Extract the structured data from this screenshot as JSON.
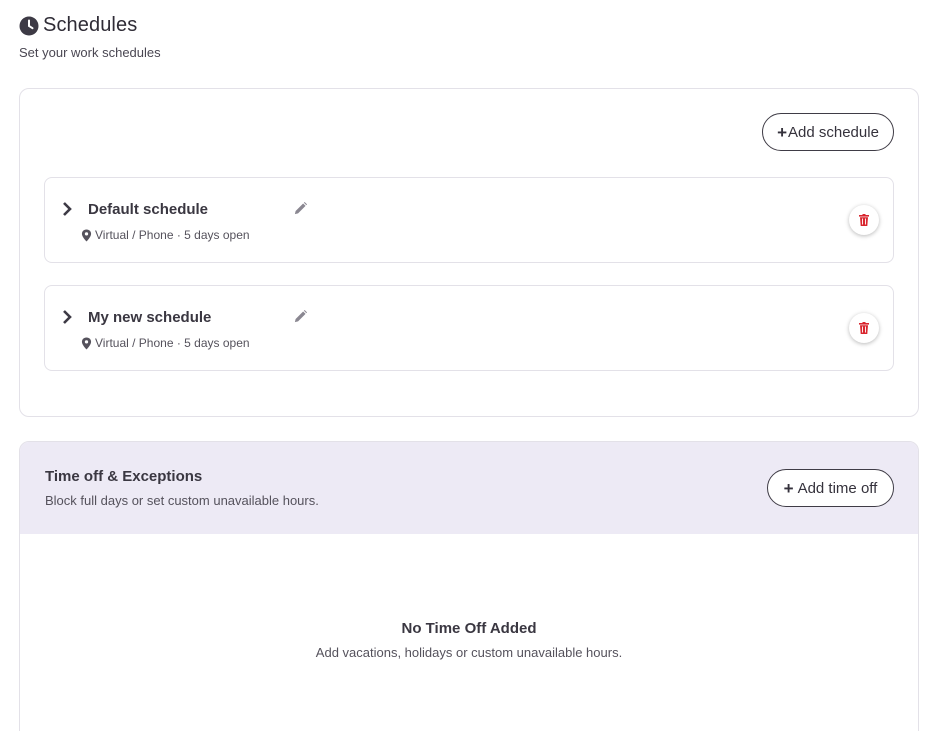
{
  "header": {
    "title": "Schedules",
    "subtitle": "Set your work schedules"
  },
  "schedules": {
    "add_button_label": "Add schedule",
    "items": [
      {
        "name": "Default schedule",
        "meta": "Virtual / Phone · 5 days open"
      },
      {
        "name": "My new schedule",
        "meta": "Virtual / Phone · 5 days open"
      }
    ]
  },
  "time_off": {
    "title": "Time off & Exceptions",
    "subtitle": "Block full days or set custom unavailable hours.",
    "add_button_label": "Add time off",
    "empty_title": "No Time Off Added",
    "empty_subtitle": "Add vacations, holidays or custom unavailable hours."
  },
  "icons": {
    "title_icon": "clock-icon",
    "expand_icon": "chevron-right-icon",
    "edit_icon": "pencil-icon",
    "location_icon": "map-pin-icon",
    "delete_icon": "trash-icon",
    "add_icon": "plus-icon"
  },
  "colors": {
    "delete_red": "#d9262f",
    "timeoff_header_bg": "#edeaf5",
    "border": "#e3e1e8"
  }
}
